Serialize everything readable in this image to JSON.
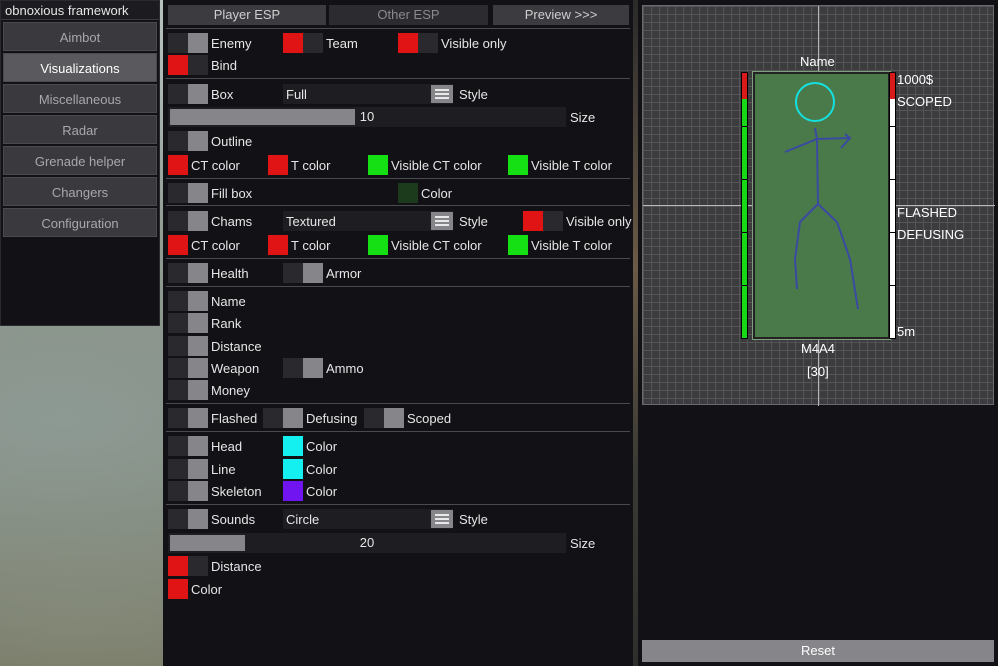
{
  "menu": {
    "title": "obnoxious framework",
    "items": [
      "Aimbot",
      "Visualizations",
      "Miscellaneous",
      "Radar",
      "Grenade helper",
      "Changers",
      "Configuration"
    ]
  },
  "tabs": {
    "player_esp": "Player ESP",
    "other_esp": "Other ESP",
    "preview": "Preview >>>"
  },
  "colors": {
    "red": "#e01414",
    "green": "#14e014",
    "cyan": "#14f0f0",
    "purple": "#7014f0",
    "dark_green": "#1c3a1c"
  },
  "filters": {
    "enemy": "Enemy",
    "team": "Team",
    "visible_only": "Visible only",
    "bind": "Bind"
  },
  "box": {
    "label": "Box",
    "style_value": "Full",
    "style_label": "Style",
    "size_value": "10",
    "size_fraction": 0.47,
    "size_label": "Size",
    "outline": "Outline"
  },
  "colorset1": {
    "ct": "CT color",
    "t": "T color",
    "visible_ct": "Visible CT color",
    "visible_t": "Visible T color"
  },
  "fill": {
    "label": "Fill box",
    "color_label": "Color"
  },
  "chams": {
    "label": "Chams",
    "style_value": "Textured",
    "style_label": "Style",
    "visible_only": "Visible only"
  },
  "colorset2": {
    "ct": "CT color",
    "t": "T color",
    "visible_ct": "Visible CT color",
    "visible_t": "Visible T color"
  },
  "bars": {
    "health": "Health",
    "armor": "Armor"
  },
  "info": {
    "name": "Name",
    "rank": "Rank",
    "distance": "Distance",
    "weapon": "Weapon",
    "ammo": "Ammo",
    "money": "Money"
  },
  "flags": {
    "flashed": "Flashed",
    "defusing": "Defusing",
    "scoped": "Scoped"
  },
  "parts": {
    "head": "Head",
    "line": "Line",
    "skeleton": "Skeleton",
    "color": "Color"
  },
  "sounds": {
    "label": "Sounds",
    "style_value": "Circle",
    "style_label": "Style",
    "size_value": "20",
    "size_fraction": 0.19,
    "size_label": "Size",
    "distance": "Distance",
    "color": "Color"
  },
  "preview": {
    "name": "Name",
    "money": "1000$",
    "scoped": "SCOPED",
    "flashed": "FLASHED",
    "defusing": "DEFUSING",
    "distance": "5m",
    "weapon": "M4A4",
    "ammo": "[30]",
    "reset": "Reset",
    "head_color": "#14e0e0",
    "skeleton_color": "#3a4aa0"
  }
}
